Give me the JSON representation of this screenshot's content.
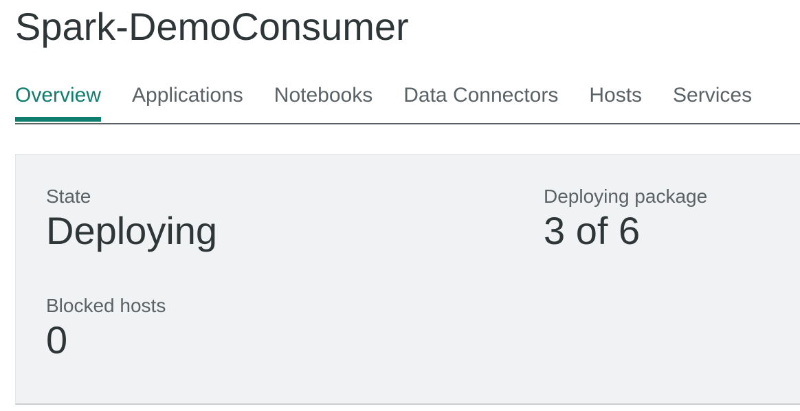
{
  "header": {
    "title": "Spark-DemoConsumer"
  },
  "tabs": [
    {
      "label": "Overview",
      "active": true
    },
    {
      "label": "Applications",
      "active": false
    },
    {
      "label": "Notebooks",
      "active": false
    },
    {
      "label": "Data Connectors",
      "active": false
    },
    {
      "label": "Hosts",
      "active": false
    },
    {
      "label": "Services",
      "active": false
    }
  ],
  "overview": {
    "state": {
      "label": "State",
      "value": "Deploying"
    },
    "deploying_package": {
      "label": "Deploying package",
      "value": "3 of 6"
    },
    "blocked_hosts": {
      "label": "Blocked hosts",
      "value": "0"
    }
  },
  "colors": {
    "accent": "#107e6e",
    "text_primary": "#2f3638",
    "text_secondary": "#5b6266",
    "panel_background": "#f0f2f3"
  }
}
